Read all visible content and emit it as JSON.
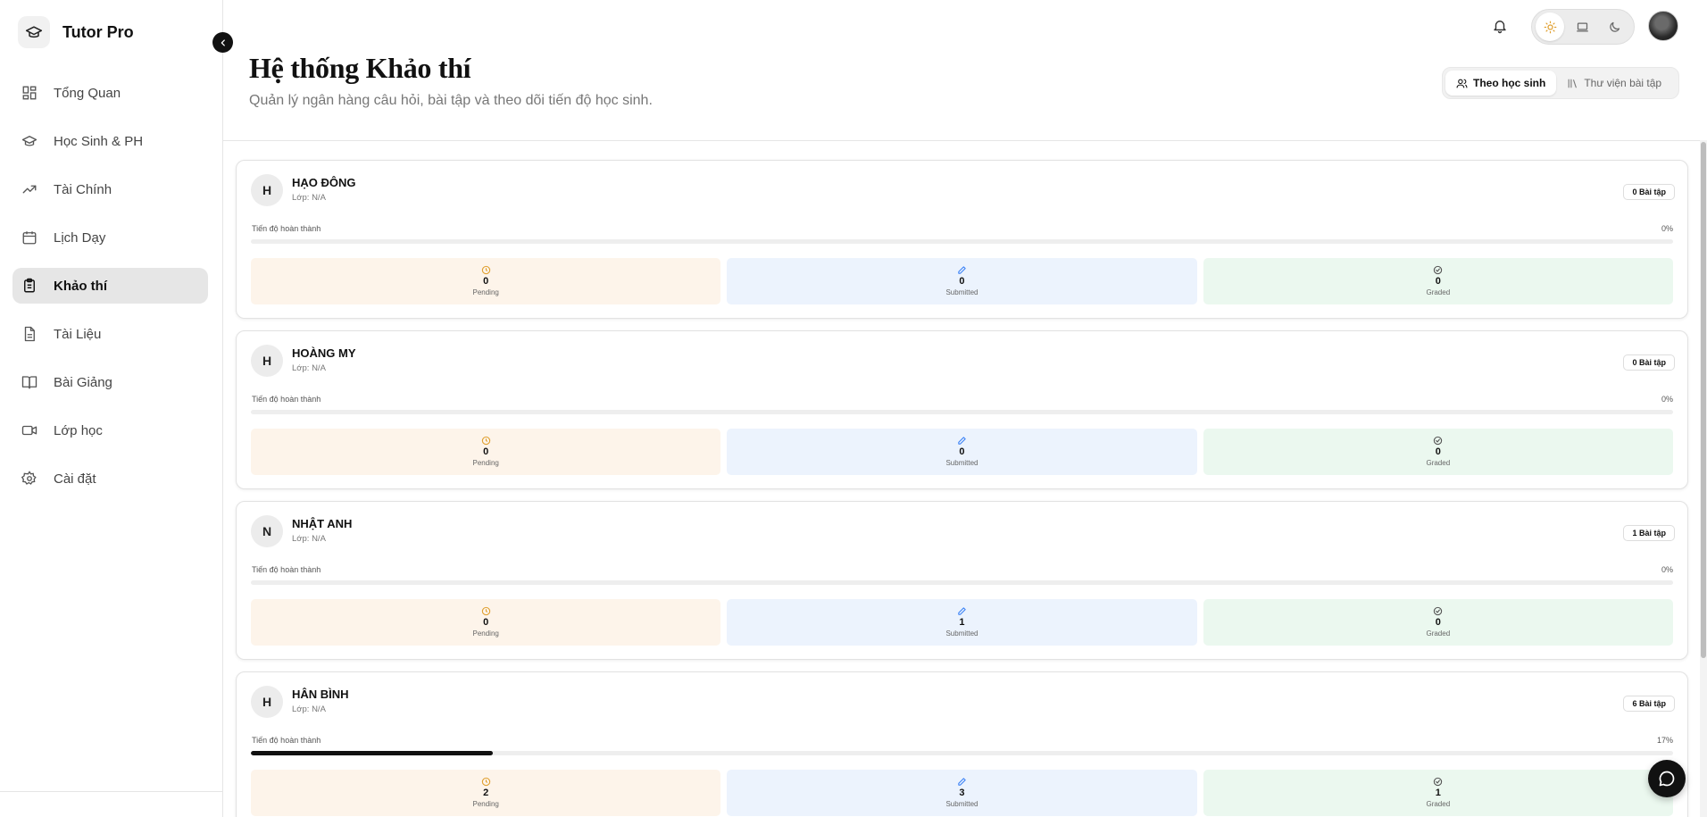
{
  "app": {
    "name": "Tutor Pro"
  },
  "sidebar": {
    "items": [
      {
        "label": "Tổng Quan",
        "icon": "dashboard-icon",
        "active": false
      },
      {
        "label": "Học Sinh & PH",
        "icon": "graduation-cap-icon",
        "active": false
      },
      {
        "label": "Tài Chính",
        "icon": "trending-up-icon",
        "active": false
      },
      {
        "label": "Lịch Dạy",
        "icon": "calendar-icon",
        "active": false
      },
      {
        "label": "Khảo thí",
        "icon": "clipboard-icon",
        "active": true
      },
      {
        "label": "Tài Liệu",
        "icon": "document-icon",
        "active": false
      },
      {
        "label": "Bài Giảng",
        "icon": "book-icon",
        "active": false
      },
      {
        "label": "Lớp học",
        "icon": "video-icon",
        "active": false
      },
      {
        "label": "Cài đặt",
        "icon": "gear-icon",
        "active": false
      }
    ]
  },
  "topbar": {
    "theme_options": [
      "light",
      "system",
      "dark"
    ],
    "theme_selected": "light"
  },
  "header": {
    "title": "Hệ thống Khảo thí",
    "subtitle": "Quản lý ngân hàng câu hỏi, bài tập và theo dõi tiến độ học sinh.",
    "view_tabs": [
      {
        "label": "Theo học sinh",
        "icon": "users-icon",
        "active": true
      },
      {
        "label": "Thư viện bài tập",
        "icon": "library-icon",
        "active": false
      }
    ]
  },
  "students": [
    {
      "initial": "H",
      "name": "HẠO ĐÔNG",
      "class": "Lớp: N/A",
      "badge": "0 Bài tập",
      "progress_label": "Tiến độ hoàn thành",
      "progress_text": "0%",
      "progress": 0,
      "pending": "0",
      "pending_label": "Pending",
      "submitted": "0",
      "submitted_label": "Submitted",
      "graded": "0",
      "graded_label": "Graded"
    },
    {
      "initial": "H",
      "name": "HOÀNG MY",
      "class": "Lớp: N/A",
      "badge": "0 Bài tập",
      "progress_label": "Tiến độ hoàn thành",
      "progress_text": "0%",
      "progress": 0,
      "pending": "0",
      "pending_label": "Pending",
      "submitted": "0",
      "submitted_label": "Submitted",
      "graded": "0",
      "graded_label": "Graded"
    },
    {
      "initial": "N",
      "name": "NHẬT ANH",
      "class": "Lớp: N/A",
      "badge": "1 Bài tập",
      "progress_label": "Tiến độ hoàn thành",
      "progress_text": "0%",
      "progress": 0,
      "pending": "0",
      "pending_label": "Pending",
      "submitted": "1",
      "submitted_label": "Submitted",
      "graded": "0",
      "graded_label": "Graded"
    },
    {
      "initial": "H",
      "name": "HÂN BÌNH",
      "class": "Lớp: N/A",
      "badge": "6 Bài tập",
      "progress_label": "Tiến độ hoàn thành",
      "progress_text": "17%",
      "progress": 0.17,
      "pending": "2",
      "pending_label": "Pending",
      "submitted": "3",
      "submitted_label": "Submitted",
      "graded": "1",
      "graded_label": "Graded"
    }
  ],
  "colors": {
    "pending": "#fdf4ea",
    "submitted": "#ecf3fd",
    "graded": "#ebf8ef",
    "pending_icon": "#e0a030",
    "submitted_icon": "#3b82f6",
    "graded_icon": "#555555",
    "accent": "#111111"
  }
}
